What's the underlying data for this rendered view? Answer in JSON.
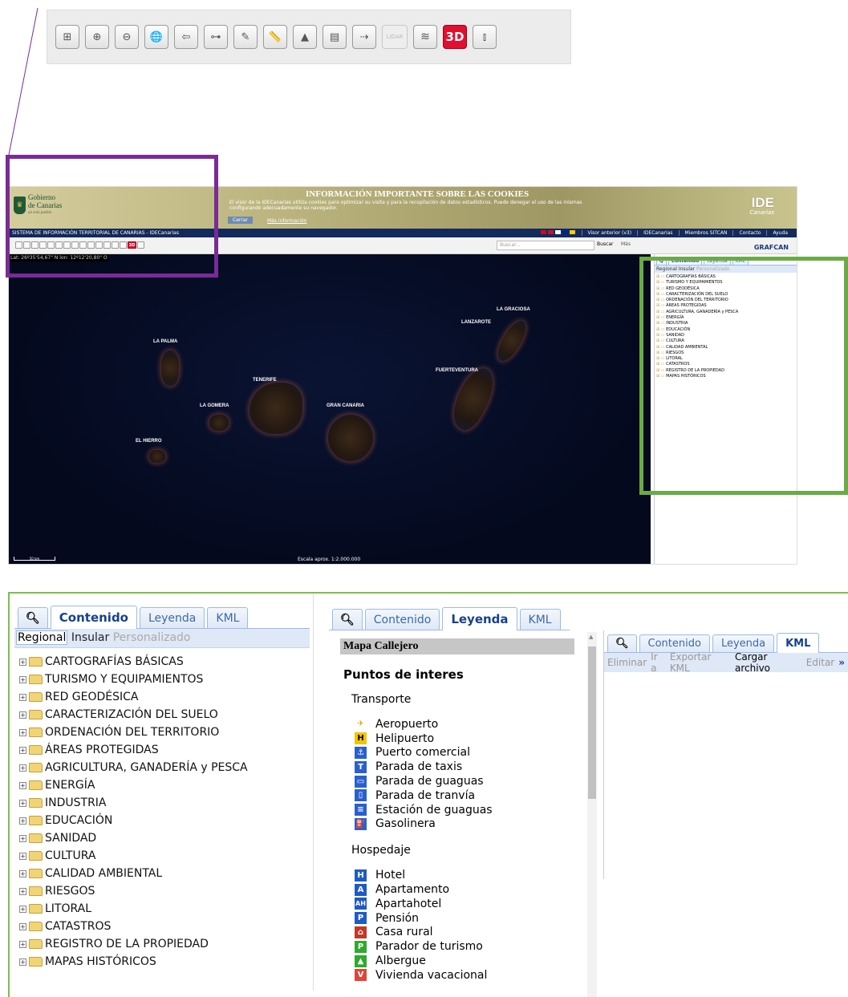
{
  "colors": {
    "accent_purple": "#7a2b97",
    "accent_green": "#6aab46",
    "ext_blue": "#15428b",
    "btn_3d": "#e01030"
  },
  "toolbar": {
    "buttons": [
      {
        "name": "zoom-box-button",
        "glyph": "⊞"
      },
      {
        "name": "zoom-in-button",
        "glyph": "⊕"
      },
      {
        "name": "zoom-out-button",
        "glyph": "⊖"
      },
      {
        "name": "full-extent-button",
        "glyph": "🌐"
      },
      {
        "name": "previous-extent-button",
        "glyph": "⇦"
      },
      {
        "name": "link-button",
        "glyph": "⊶"
      },
      {
        "name": "draw-button",
        "glyph": "✎"
      },
      {
        "name": "measure-button",
        "glyph": "📏"
      },
      {
        "name": "profile-button",
        "glyph": "▲"
      },
      {
        "name": "print-button",
        "glyph": "▤"
      },
      {
        "name": "route-button",
        "glyph": "⇢"
      }
    ],
    "lidar_label": "LIDAR",
    "layers_glyph": "≋",
    "three_d_label": "3D",
    "split_glyph": "⫾"
  },
  "app": {
    "logo_line1": "Gobierno",
    "logo_line2": "de Canarias",
    "logo_tagline": "un solo pueblo",
    "cookie_title": "INFORMACIÓN IMPORTANTE SOBRE LAS COOKIES",
    "cookie_text": "El visor de la IDECanarias utiliza cookies para optimizar su visita y para la recopilación de datos estadísticos. Puede denegar el uso de las mismas configurando adecuadamente su navegador.",
    "cookie_close": "Cerrar",
    "cookie_more": "Más información",
    "ide_logo": "IDE",
    "ide_sub": "Canarias",
    "system_title": "SISTEMA DE INFORMACIÓN TERRITORIAL DE CANARIAS - IDECanarias",
    "nav_links": [
      "Visor anterior (v3)",
      "IDECanarias",
      "Miembros SITCAN",
      "Contacto",
      "Ayuda"
    ],
    "search_placeholder": "Buscar...",
    "search_button": "Buscar",
    "more_button": "Más",
    "grafcan": "GRAFCAN",
    "coords": "Lat: 26º35'54,67\" N  lon: 12º12'20,80\" O",
    "islands": [
      "LA PALMA",
      "LA GOMERA",
      "EL HIERRO",
      "TENERIFE",
      "GRAN CANARIA",
      "FUERTEVENTURA",
      "LANZAROTE",
      "LA GRACIOSA"
    ],
    "scale_bar": "50 km",
    "scale_text": "Escala aprox. 1:2.000.000"
  },
  "panel_tabs": [
    "Contenido",
    "Leyenda",
    "KML"
  ],
  "content_panel": {
    "subtabs": [
      "Regional",
      "Insular",
      "Personalizado"
    ],
    "tree": [
      "CARTOGRAFÍAS BÁSICAS",
      "TURISMO Y EQUIPAMIENTOS",
      "RED GEODÉSICA",
      "CARACTERIZACIÓN DEL SUELO",
      "ORDENACIÓN DEL TERRITORIO",
      "ÁREAS PROTEGIDAS",
      "AGRICULTURA, GANADERÍA y PESCA",
      "ENERGÍA",
      "INDUSTRIA",
      "EDUCACIÓN",
      "SANIDAD",
      "CULTURA",
      "CALIDAD AMBIENTAL",
      "RIESGOS",
      "LITORAL",
      "CATASTROS",
      "REGISTRO DE LA PROPIEDAD",
      "MAPAS HISTÓRICOS"
    ]
  },
  "legend_panel": {
    "map_title": "Mapa Callejero",
    "section": "Puntos de interes",
    "categories": [
      {
        "name": "Transporte",
        "items": [
          {
            "label": "Aeropuerto",
            "icon": "airplane-icon",
            "glyph": "✈",
            "color": "#e0a800",
            "bg": "transparent"
          },
          {
            "label": "Helipuerto",
            "icon": "heliport-icon",
            "glyph": "H",
            "color": "#000",
            "bg": "#f2c400"
          },
          {
            "label": "Puerto comercial",
            "icon": "port-icon",
            "glyph": "⚓",
            "color": "#fff",
            "bg": "#2a5fd0"
          },
          {
            "label": "Parada de taxis",
            "icon": "taxi-icon",
            "glyph": "T",
            "color": "#fff",
            "bg": "#2a5fd0"
          },
          {
            "label": "Parada de guaguas",
            "icon": "bus-stop-icon",
            "glyph": "▭",
            "color": "#fff",
            "bg": "#2a5fd0"
          },
          {
            "label": "Parada de tranvía",
            "icon": "tram-icon",
            "glyph": "▯",
            "color": "#fff",
            "bg": "#2a5fd0"
          },
          {
            "label": "Estación de guaguas",
            "icon": "bus-station-icon",
            "glyph": "≡",
            "color": "#fff",
            "bg": "#2a5fd0"
          },
          {
            "label": "Gasolinera",
            "icon": "gas-station-icon",
            "glyph": "⛽",
            "color": "#fff",
            "bg": "#2a5fd0"
          }
        ]
      },
      {
        "name": "Hospedaje",
        "items": [
          {
            "label": "Hotel",
            "icon": "hotel-icon",
            "glyph": "H",
            "color": "#fff",
            "bg": "#1e5bc6"
          },
          {
            "label": "Apartamento",
            "icon": "apartment-icon",
            "glyph": "A",
            "color": "#fff",
            "bg": "#1e5bc6"
          },
          {
            "label": "Apartahotel",
            "icon": "aparthotel-icon",
            "glyph": "AH",
            "color": "#fff",
            "bg": "#1e5bc6"
          },
          {
            "label": "Pensión",
            "icon": "pension-icon",
            "glyph": "P",
            "color": "#fff",
            "bg": "#1e5bc6"
          },
          {
            "label": "Casa rural",
            "icon": "rural-house-icon",
            "glyph": "⌂",
            "color": "#fff",
            "bg": "#c0392b"
          },
          {
            "label": "Parador de turismo",
            "icon": "parador-icon",
            "glyph": "P",
            "color": "#fff",
            "bg": "#2eaa2e"
          },
          {
            "label": "Albergue",
            "icon": "hostel-icon",
            "glyph": "▲",
            "color": "#fff",
            "bg": "#2eaa2e"
          },
          {
            "label": "Vivienda vacacional",
            "icon": "vacation-home-icon",
            "glyph": "V",
            "color": "#fff",
            "bg": "#e0453a"
          }
        ]
      }
    ]
  },
  "kml_panel": {
    "actions": [
      "Eliminar",
      "Ir a",
      "Exportar KML",
      "Cargar archivo",
      "Editar"
    ],
    "expand": "»"
  }
}
